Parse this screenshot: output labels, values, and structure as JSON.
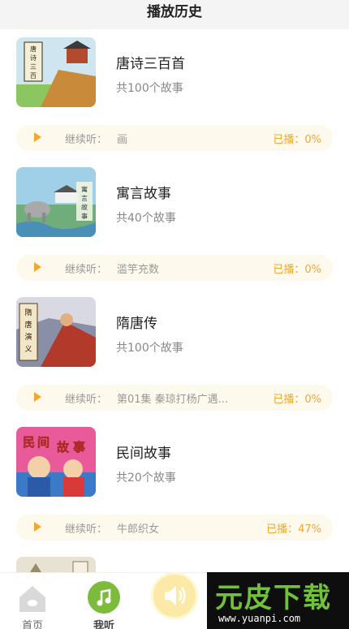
{
  "header": {
    "title": "播放历史"
  },
  "items": [
    {
      "title": "唐诗三百首",
      "count": "共100个故事",
      "continue_label": "继续听：",
      "continue_value": "画",
      "played": "已播：0%",
      "cover_text": "唐诗三百首"
    },
    {
      "title": "寓言故事",
      "count": "共40个故事",
      "continue_label": "继续听：",
      "continue_value": "滥竽充数",
      "played": "已播：0%",
      "cover_text": "寓言故事"
    },
    {
      "title": "隋唐传",
      "count": "共100个故事",
      "continue_label": "继续听：",
      "continue_value": "第01集  秦琼打杨广遇...",
      "played": "已播：0%",
      "cover_text": "隋唐演义"
    },
    {
      "title": "民间故事",
      "count": "共20个故事",
      "continue_label": "继续听：",
      "continue_value": "牛郎织女",
      "played": "已播：47%",
      "cover_text": "民间故事"
    }
  ],
  "tabbar": {
    "home_label": "首页",
    "mine_label": "我听"
  },
  "watermark": {
    "main": "元皮下载",
    "url": "www.yuanpi.com"
  },
  "colors": {
    "accent": "#f0a830",
    "active_tab": "#7dbb3c",
    "progress_bg": "#fdf9ec"
  }
}
